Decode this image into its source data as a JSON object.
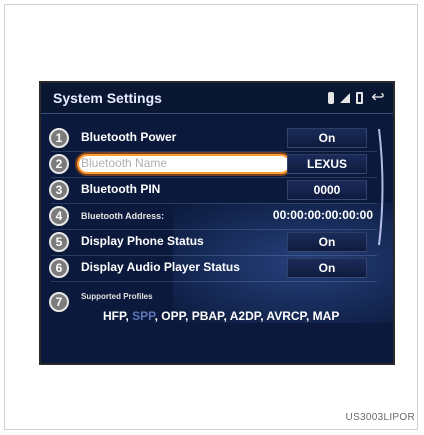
{
  "header": {
    "title": "System Settings",
    "icons": [
      "bluetooth-icon",
      "signal-strength-icon",
      "battery-icon",
      "back-icon"
    ],
    "back_glyph": "↩"
  },
  "rows": [
    {
      "number": "1",
      "label": "Bluetooth Power",
      "value": "On"
    },
    {
      "number": "2",
      "label": "Bluetooth Name",
      "value": "LEXUS"
    },
    {
      "number": "3",
      "label": "Bluetooth PIN",
      "value": "0000"
    },
    {
      "number": "4",
      "label": "Bluetooth Address:",
      "value": "00:00:00:00:00:00"
    },
    {
      "number": "5",
      "label": "Display Phone Status",
      "value": "On"
    },
    {
      "number": "6",
      "label": "Display Audio Player Status",
      "value": "On"
    }
  ],
  "profiles": {
    "number": "7",
    "label": "Supported Profiles",
    "value_prefix": "HFP, ",
    "value_dim": "SPP",
    "value_suffix": ", OPP, PBAP, A2DP, AVRCP, MAP"
  },
  "image_code": "US3003LIPOR",
  "colors": {
    "screen_bg": "#0b1a3c",
    "highlight_border": "#ff9b2f",
    "text": "#ffffff"
  }
}
